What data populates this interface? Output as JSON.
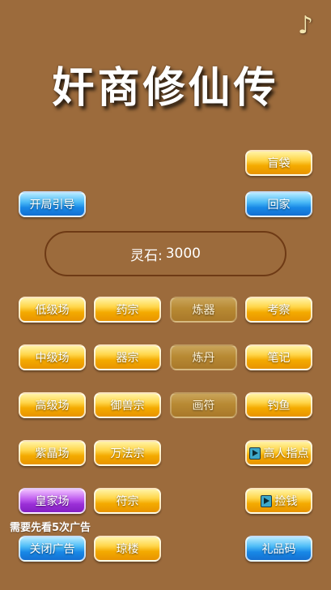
{
  "title": "奸商修仙传",
  "stone": {
    "label": "灵石:",
    "value": "3000"
  },
  "ad_hint": "需要先看5次广告",
  "buttons": {
    "blind_bag": "盲袋",
    "start_guide": "开局引导",
    "go_home": "回家",
    "low_market": "低级场",
    "medicine_sect": "药宗",
    "refine_tool": "炼器",
    "inspect": "考察",
    "mid_market": "中级场",
    "tool_sect": "器宗",
    "refine_pill": "炼丹",
    "notes": "笔记",
    "high_market": "高级场",
    "beast_sect": "御兽宗",
    "draw_talisman": "画符",
    "fishing": "钓鱼",
    "purple_market": "紫晶场",
    "method_sect": "万法宗",
    "master_tip": "高人指点",
    "royal_market": "皇家场",
    "talisman_sect": "符宗",
    "pick_money": "捡钱",
    "close_ads": "关闭广告",
    "jade_tower": "琼楼",
    "gift_code": "礼品码"
  },
  "icons": {
    "music": "music-note-icon",
    "play": "video-play-icon"
  },
  "colors": {
    "background": "#9c6b3c",
    "gold": "#f4aa00",
    "blue": "#1888e6",
    "purple": "#9a2fd6"
  }
}
